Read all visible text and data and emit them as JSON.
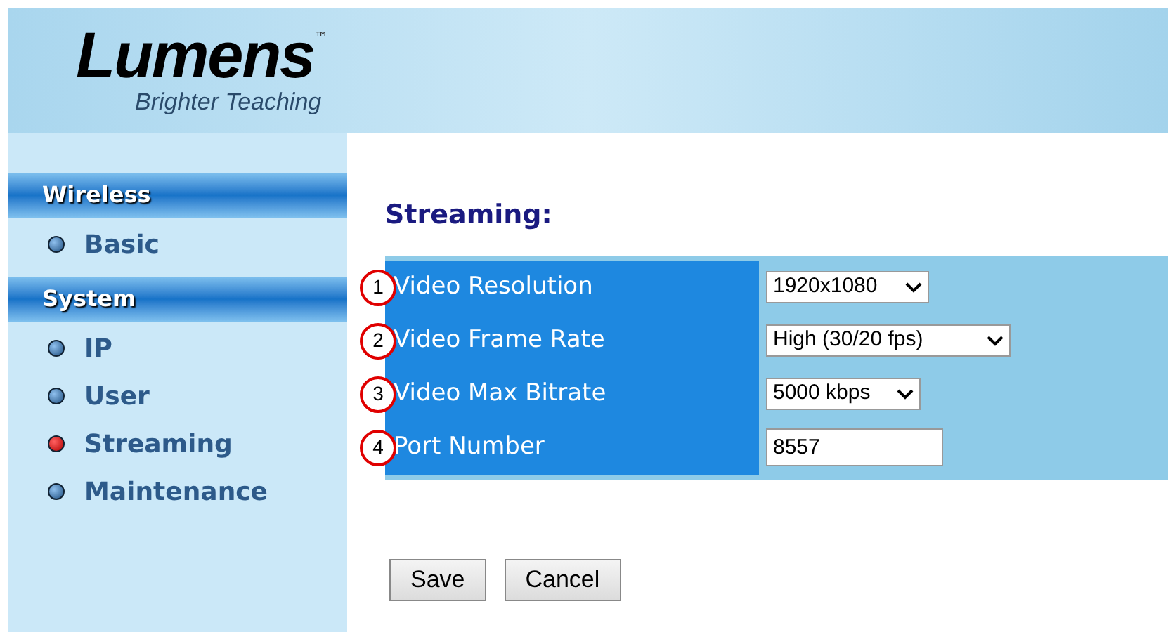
{
  "header": {
    "logo": "Lumens",
    "trademark": "™",
    "tagline": "Brighter Teaching"
  },
  "sidebar": {
    "sections": [
      {
        "title": "Wireless",
        "items": [
          {
            "label": "Basic",
            "selected": false
          }
        ]
      },
      {
        "title": "System",
        "items": [
          {
            "label": "IP",
            "selected": false
          },
          {
            "label": "User",
            "selected": false
          },
          {
            "label": "Streaming",
            "selected": true
          },
          {
            "label": "Maintenance",
            "selected": false
          }
        ]
      }
    ]
  },
  "page_title": "Streaming:",
  "fields": [
    {
      "callout": "1",
      "label": "Video Resolution",
      "kind": "select",
      "value": "1920x1080"
    },
    {
      "callout": "2",
      "label": "Video Frame Rate",
      "kind": "select",
      "value": "High (30/20 fps)"
    },
    {
      "callout": "3",
      "label": "Video Max Bitrate",
      "kind": "select",
      "value": "5000 kbps"
    },
    {
      "callout": "4",
      "label": "Port Number",
      "kind": "input",
      "value": "8557"
    }
  ],
  "buttons": [
    "Save",
    "Cancel"
  ]
}
